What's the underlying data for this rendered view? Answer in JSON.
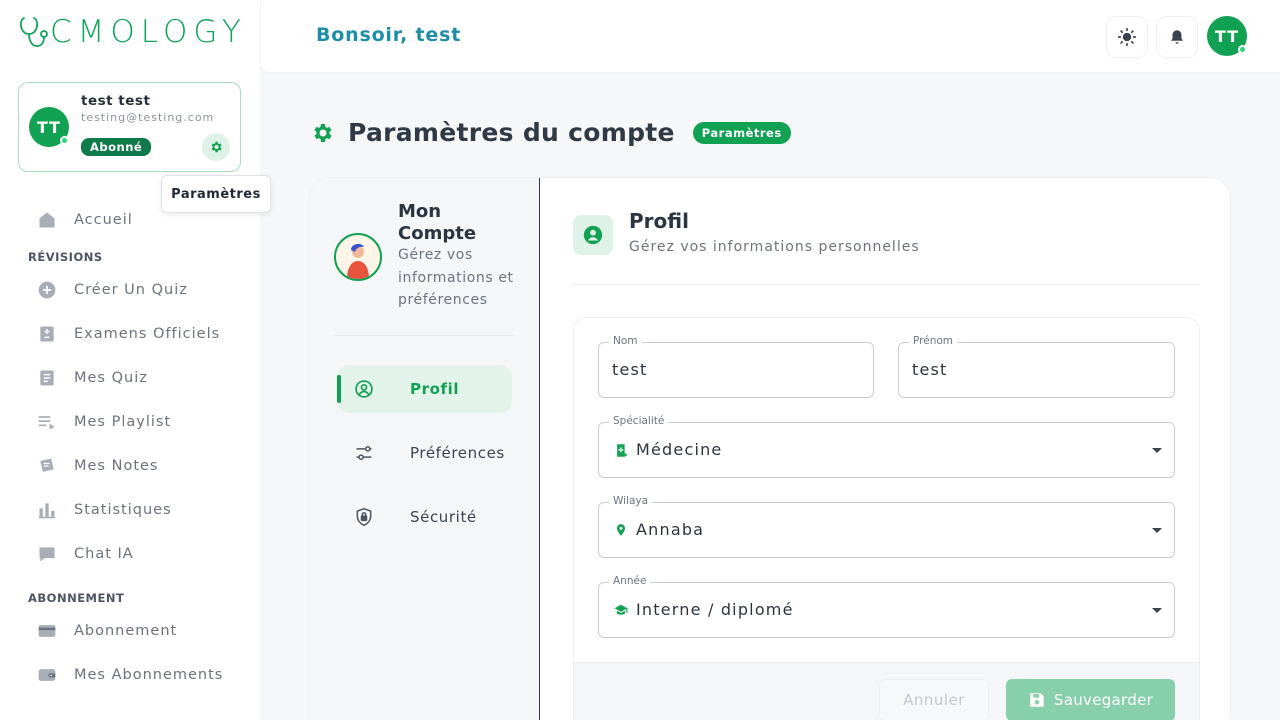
{
  "brand": {
    "name": "CMOLOGY",
    "accent": "#10a152"
  },
  "sidebar": {
    "user": {
      "initials": "TT",
      "name": "test test",
      "email": "testing@testing.com",
      "badge": "Abonné",
      "settings_tooltip": "Paramètres"
    },
    "home": {
      "label": "Accueil",
      "icon": "home-icon"
    },
    "sections": [
      {
        "title": "RÉVISIONS",
        "items": [
          {
            "label": "Créer Un Quiz",
            "icon": "plus-circle-icon"
          },
          {
            "label": "Examens Officiels",
            "icon": "exam-icon"
          },
          {
            "label": "Mes Quiz",
            "icon": "document-icon"
          },
          {
            "label": "Mes Playlist",
            "icon": "playlist-icon"
          },
          {
            "label": "Mes Notes",
            "icon": "notes-icon"
          },
          {
            "label": "Statistiques",
            "icon": "bar-chart-icon"
          },
          {
            "label": "Chat IA",
            "icon": "chat-icon"
          }
        ]
      },
      {
        "title": "ABONNEMENT",
        "items": [
          {
            "label": "Abonnement",
            "icon": "card-icon"
          },
          {
            "label": "Mes Abonnements",
            "icon": "wallet-icon"
          }
        ]
      }
    ]
  },
  "topbar": {
    "greeting": "Bonsoir, test",
    "theme_icon": "sun-icon",
    "notification_icon": "bell-icon",
    "initials": "TT"
  },
  "page": {
    "title": "Paramètres du compte",
    "badge": "Paramètres"
  },
  "account_panel": {
    "title": "Mon Compte",
    "description": "Gérez vos informations et préférences",
    "menu": [
      {
        "label": "Profil",
        "icon": "user-circle-icon",
        "active": true
      },
      {
        "label": "Préférences",
        "icon": "sliders-icon",
        "active": false
      },
      {
        "label": "Sécurité",
        "icon": "shield-lock-icon",
        "active": false
      }
    ]
  },
  "profile": {
    "title": "Profil",
    "subtitle": "Gérez vos informations personnelles",
    "fields": {
      "nom": {
        "label": "Nom",
        "value": "test"
      },
      "prenom": {
        "label": "Prénom",
        "value": "test"
      },
      "specialite": {
        "label": "Spécialité",
        "value": "Médecine",
        "icon": "medical-book-icon"
      },
      "wilaya": {
        "label": "Wilaya",
        "value": "Annaba",
        "icon": "location-pin-icon"
      },
      "annee": {
        "label": "Année",
        "value": "Interne / diplomé",
        "icon": "graduation-cap-icon"
      }
    },
    "cancel_label": "Annuler",
    "save_label": "Sauvegarder"
  }
}
